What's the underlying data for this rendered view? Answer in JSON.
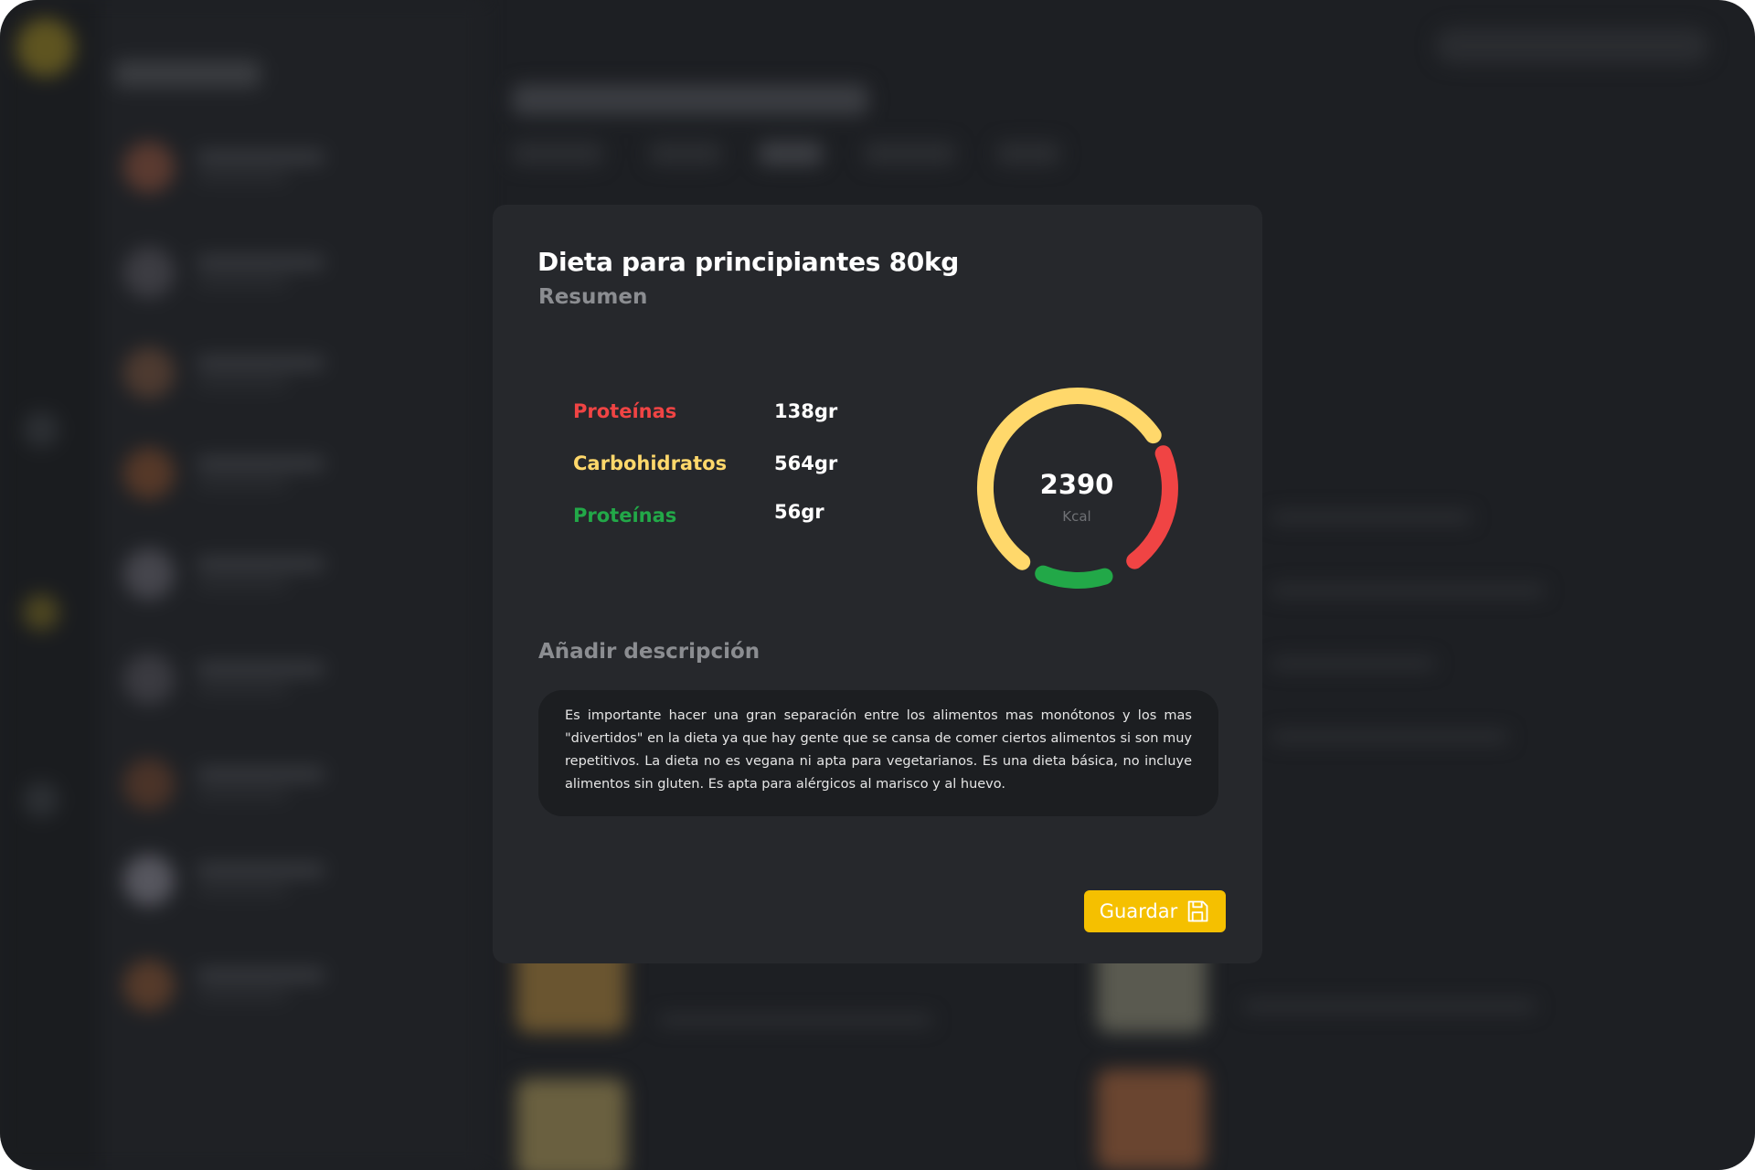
{
  "modal": {
    "title": "Dieta para principiantes 80kg",
    "subtitle": "Resumen",
    "macros": [
      {
        "label": "Proteínas",
        "value": "138gr",
        "color": "#f04444"
      },
      {
        "label": "Carbohidratos",
        "value": "564gr",
        "color": "#ffd86b"
      },
      {
        "label": "Proteínas",
        "value": "56gr",
        "color": "#22a848"
      }
    ],
    "calories": {
      "value": "2390",
      "unit": "Kcal"
    },
    "ring_segments": [
      {
        "color": "#ffd86b",
        "share": 0.56
      },
      {
        "color": "#f04444",
        "share": 0.26
      },
      {
        "color": "#22a848",
        "share": 0.1
      }
    ],
    "description_label": "Añadir descripción",
    "description": "Es importante hacer una gran separación entre los alimentos mas monótonos y los mas \"divertidos\" en la dieta ya que hay gente que se cansa de comer ciertos alimentos si son muy repetitivos. La dieta no es vegana ni apta para vegetarianos. Es una dieta básica, no incluye alimentos sin gluten. Es apta para alérgicos al marisco y al huevo.",
    "save_label": "Guardar",
    "save_icon": "floppy-disk-icon"
  },
  "colors": {
    "accent": "#f5c000",
    "modal_bg": "#26282c",
    "page_bg": "#1d1f23"
  }
}
